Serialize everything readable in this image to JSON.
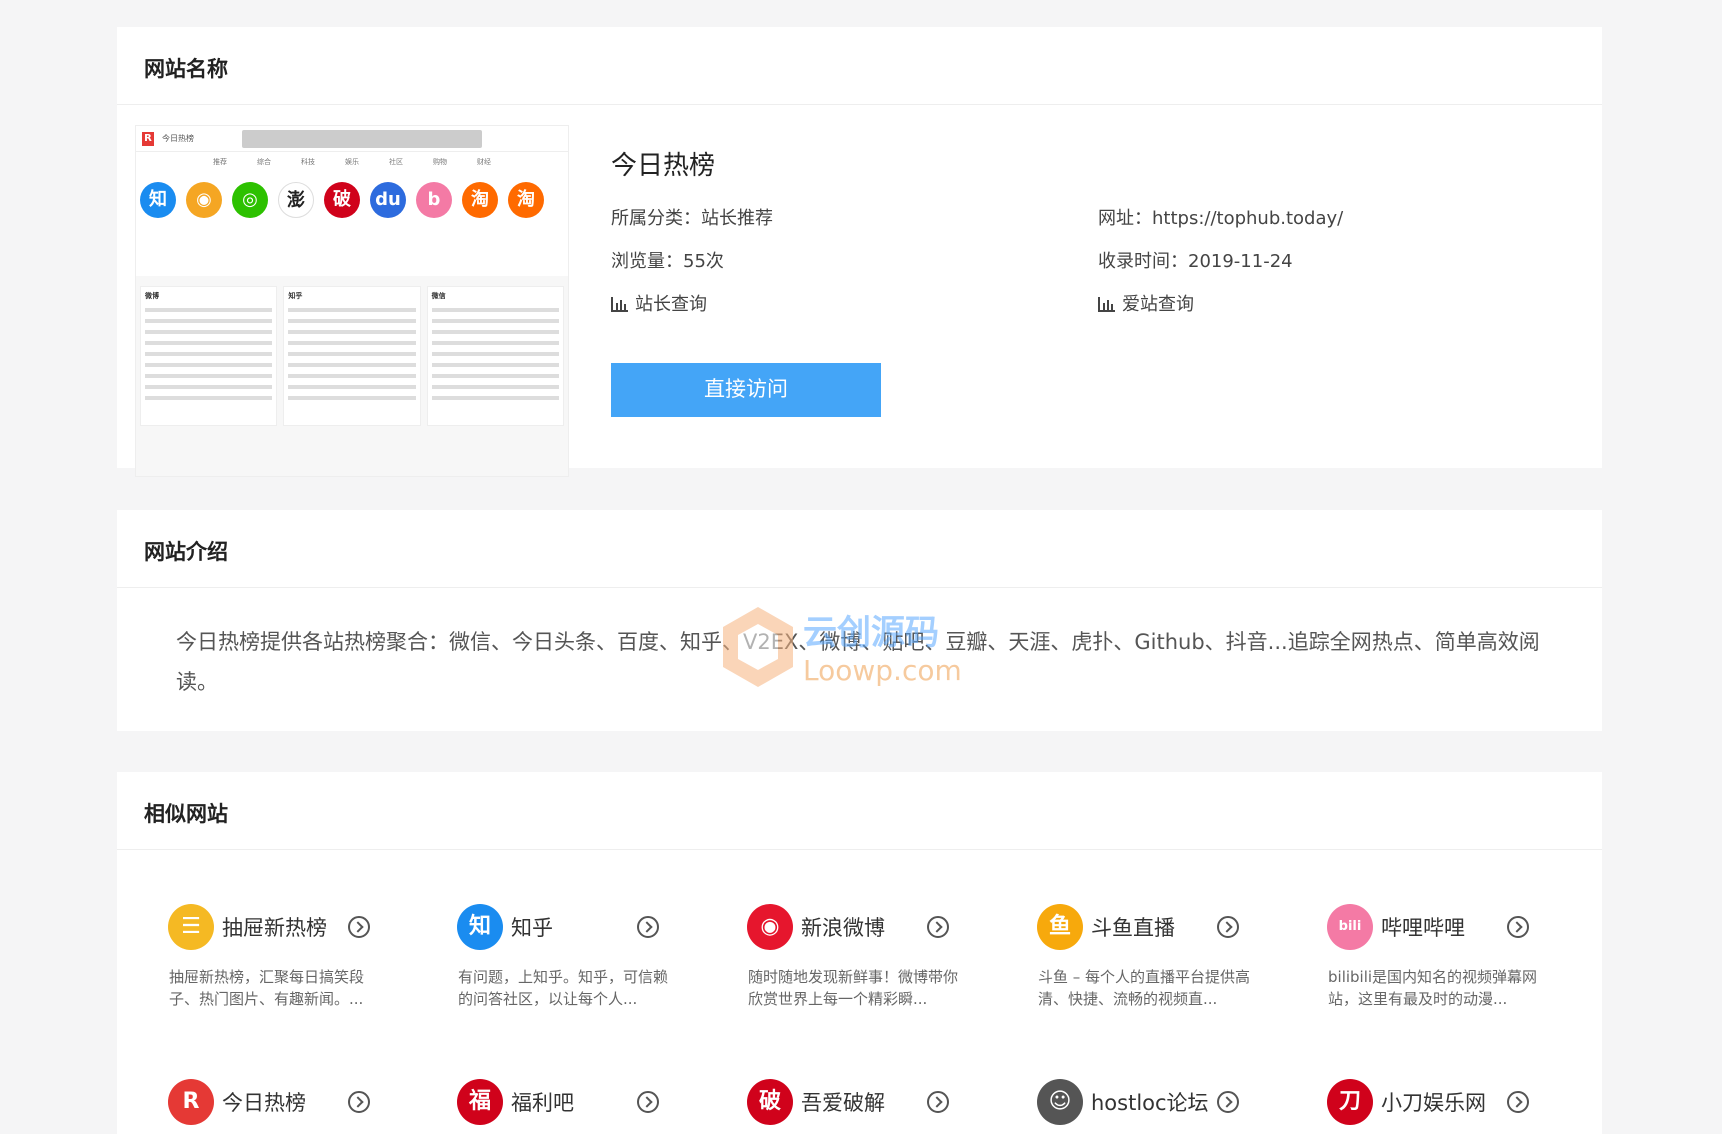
{
  "info": {
    "section_title": "网站名称",
    "site_name": "今日热榜",
    "category": "所属分类：站长推荐",
    "url": "网址：https://tophub.today/",
    "views": "浏览量：55次",
    "added": "收录时间：2019-11-24",
    "webmaster_query": "站长查询",
    "aizhan_query": "爱站查询",
    "visit_button": "直接访问",
    "screenshot": {
      "logo": "R",
      "app_name": "今日热榜",
      "nav": [
        "推荐",
        "综合",
        "科技",
        "娱乐",
        "社区",
        "购物",
        "财经"
      ],
      "icons": [
        {
          "char": "知",
          "color": "#1a8cf0"
        },
        {
          "char": "◉",
          "color": "#f5a623"
        },
        {
          "char": "◎",
          "color": "#2dc100"
        },
        {
          "char": "澎",
          "color": "#ffffff"
        },
        {
          "char": "破",
          "color": "#d0021b"
        },
        {
          "char": "du",
          "color": "#2d6bde"
        },
        {
          "char": "b",
          "color": "#f47aa5"
        },
        {
          "char": "淘",
          "color": "#ff6a00"
        },
        {
          "char": "淘",
          "color": "#ff6a00"
        }
      ],
      "cols": [
        "微博",
        "知乎",
        "微信"
      ]
    }
  },
  "intro": {
    "section_title": "网站介绍",
    "text": "今日热榜提供各站热榜聚合：微信、今日头条、百度、知乎、V2EX、微博、贴吧、豆瓣、天涯、虎扑、Github、抖音...追踪全网热点、简单高效阅读。"
  },
  "watermark": {
    "cn": "云创源码",
    "en": "Loowp.com"
  },
  "similar": {
    "section_title": "相似网站",
    "items": [
      {
        "name": "抽屉新热榜",
        "desc": "抽屉新热榜，汇聚每日搞笑段子、热门图片、有趣新闻。...",
        "icon": "☰",
        "color": "#f5b923"
      },
      {
        "name": "知乎",
        "desc": "有问题，上知乎。知乎，可信赖的问答社区，以让每个人...",
        "icon": "知",
        "color": "#1a8cf0"
      },
      {
        "name": "新浪微博",
        "desc": "随时随地发现新鲜事！微博带你欣赏世界上每一个精彩瞬...",
        "icon": "◉",
        "color": "#e6162d"
      },
      {
        "name": "斗鱼直播",
        "desc": "斗鱼 – 每个人的直播平台提供高清、快捷、流畅的视频直...",
        "icon": "鱼",
        "color": "#f7a90c"
      },
      {
        "name": "哔哩哔哩",
        "desc": "bilibili是国内知名的视频弹幕网站，这里有最及时的动漫...",
        "icon": "bili",
        "color": "#f47aa5"
      },
      {
        "name": "今日热榜",
        "desc": "",
        "icon": "R",
        "color": "#e53935"
      },
      {
        "name": "福利吧",
        "desc": "",
        "icon": "福",
        "color": "#d0021b"
      },
      {
        "name": "吾爱破解",
        "desc": "",
        "icon": "破",
        "color": "#d0021b"
      },
      {
        "name": "hostloc论坛",
        "desc": "",
        "icon": "☺",
        "color": "#555555"
      },
      {
        "name": "小刀娱乐网",
        "desc": "",
        "icon": "刀",
        "color": "#d0021b"
      }
    ]
  }
}
